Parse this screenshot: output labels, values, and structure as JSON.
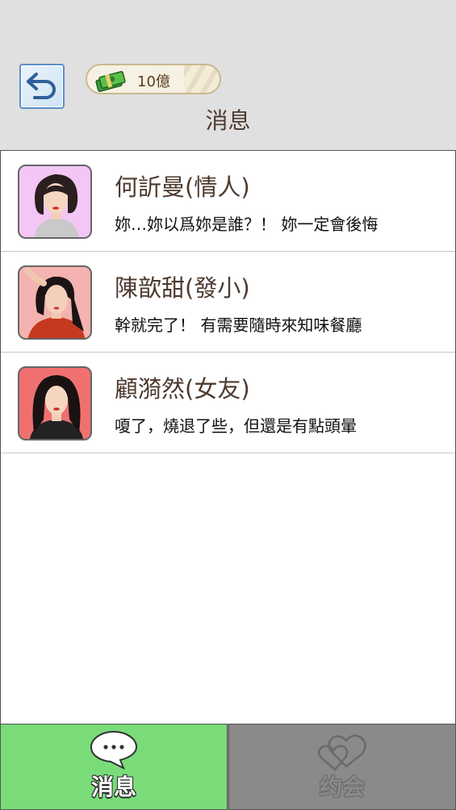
{
  "header": {
    "money": "10億",
    "title": "消息"
  },
  "contacts": [
    {
      "name": "何訢曼(情人)",
      "preview": "妳…妳以爲妳是誰？！ 妳一定會後悔",
      "avatar_bg": "#f3c6f5",
      "hair": "#2a1e1e"
    },
    {
      "name": "陳歆甜(發小)",
      "preview": "幹就完了！ 有需要隨時來知味餐廳",
      "avatar_bg": "#f4b3b0",
      "hair": "#1c1414"
    },
    {
      "name": "顧漪然(女友)",
      "preview": "嗄了，燒退了些，但還是有點頭暈",
      "avatar_bg": "#f07070",
      "hair": "#1a1212"
    }
  ],
  "tabs": {
    "messages": "消息",
    "date": "约会"
  },
  "colors": {
    "active_tab": "#79dc79",
    "inactive_tab": "#8a8a8a"
  }
}
